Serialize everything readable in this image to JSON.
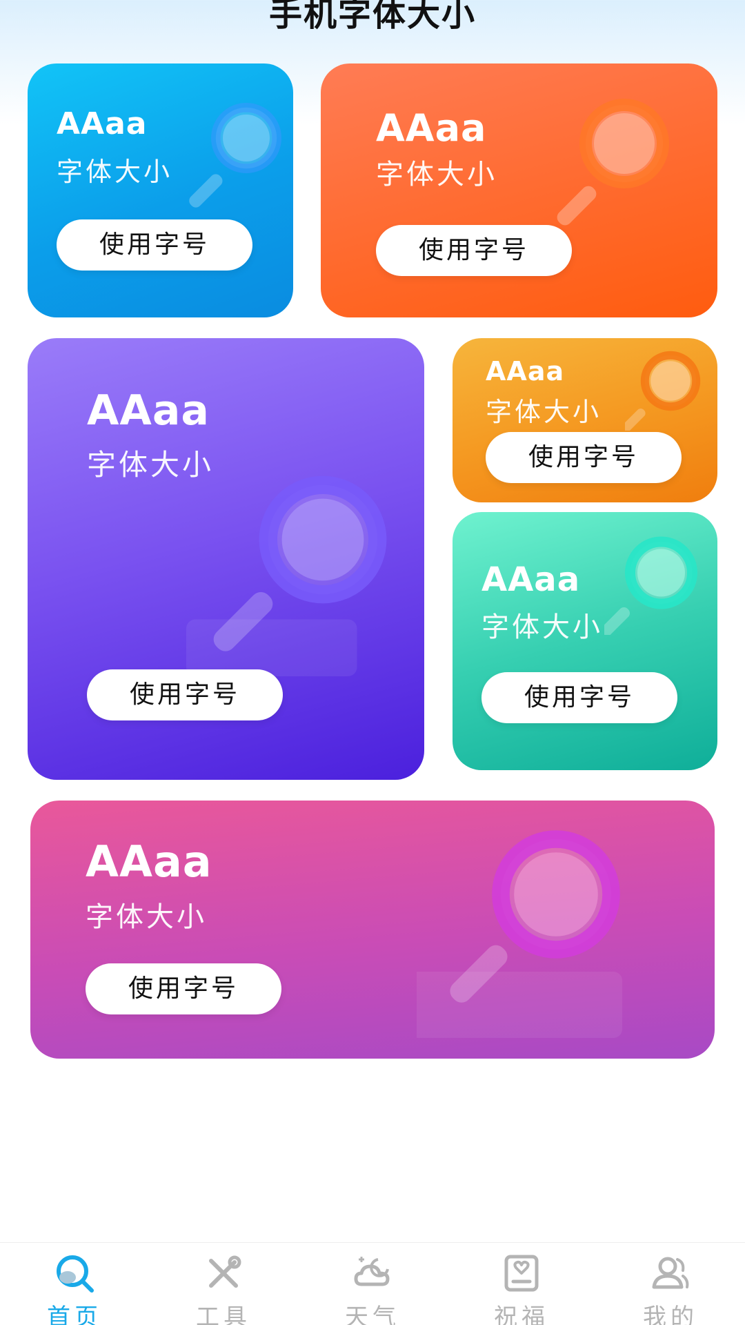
{
  "header": {
    "title": "手机字体大小"
  },
  "cards": [
    {
      "sample": "AAaa",
      "sublabel": "字体大小",
      "button": "使用字号"
    },
    {
      "sample": "AAaa",
      "sublabel": "字体大小",
      "button": "使用字号"
    },
    {
      "sample": "AAaa",
      "sublabel": "字体大小",
      "button": "使用字号"
    },
    {
      "sample": "AAaa",
      "sublabel": "字体大小",
      "button": "使用字号"
    },
    {
      "sample": "AAaa",
      "sublabel": "字体大小",
      "button": "使用字号"
    },
    {
      "sample": "AAaa",
      "sublabel": "字体大小",
      "button": "使用字号"
    }
  ],
  "card_colors": [
    "#0b9eea",
    "#ff6a2e",
    "#7a52f0",
    "#f59a22",
    "#36cfb1",
    "#c94cb6"
  ],
  "nav": {
    "items": [
      {
        "label": "首页",
        "icon": "search-home-icon",
        "active": true
      },
      {
        "label": "工具",
        "icon": "tools-icon",
        "active": false
      },
      {
        "label": "天气",
        "icon": "weather-icon",
        "active": false
      },
      {
        "label": "祝福",
        "icon": "blessing-card-icon",
        "active": false
      },
      {
        "label": "我的",
        "icon": "profile-icon",
        "active": false
      }
    ],
    "active_color": "#19a9e8",
    "inactive_color": "#b4b4b4"
  }
}
